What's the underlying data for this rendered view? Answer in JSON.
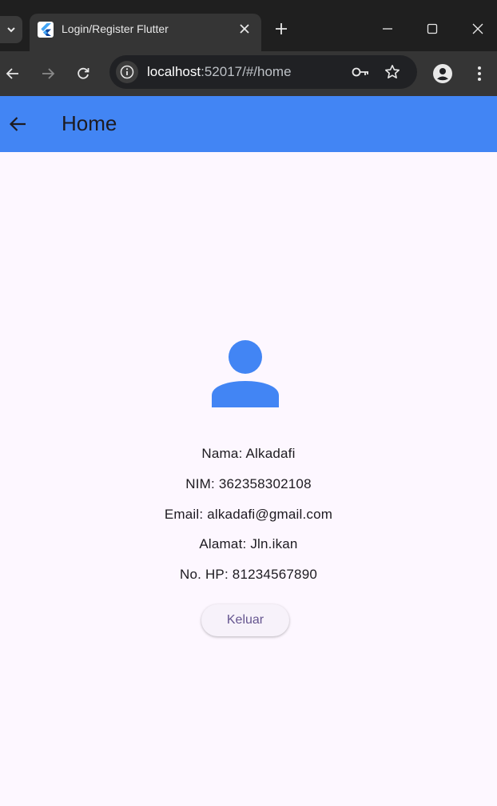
{
  "browser": {
    "tab_title": "Login/Register Flutter",
    "url_host": "localhost",
    "url_rest": ":52017/#/home"
  },
  "appbar": {
    "title": "Home"
  },
  "profile": {
    "lines": [
      "Nama: Alkadafi",
      "NIM: 362358302108",
      "Email: alkadafi@gmail.com",
      "Alamat: Jln.ikan",
      "No. HP: 81234567890"
    ],
    "logout_label": "Keluar"
  },
  "colors": {
    "accent": "#4285f4",
    "background": "#fdf7ff",
    "button_text": "#65558f"
  }
}
